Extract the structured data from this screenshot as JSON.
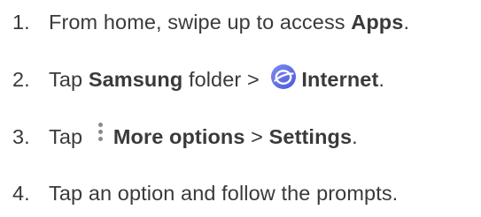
{
  "steps": [
    {
      "number": "1.",
      "text_before": "From home, swipe up to access ",
      "bold": "Apps",
      "text_after": "."
    },
    {
      "number": "2.",
      "text_before": "Tap ",
      "bold_1": "Samsung",
      "text_middle": " folder > ",
      "icon": "samsung-internet-icon",
      "bold_2": "Internet",
      "text_after": "."
    },
    {
      "number": "3.",
      "text_before": "Tap ",
      "icon": "more-options-icon",
      "bold_1": "More options",
      "text_middle": " > ",
      "bold_2": "Settings",
      "text_after": "."
    },
    {
      "number": "4.",
      "text": "Tap an option and follow the prompts."
    }
  ],
  "colors": {
    "text": "#3a3a3a",
    "internet_icon_bg": "#5b6fe6",
    "more_icon_dots": "#8a8a8a"
  }
}
